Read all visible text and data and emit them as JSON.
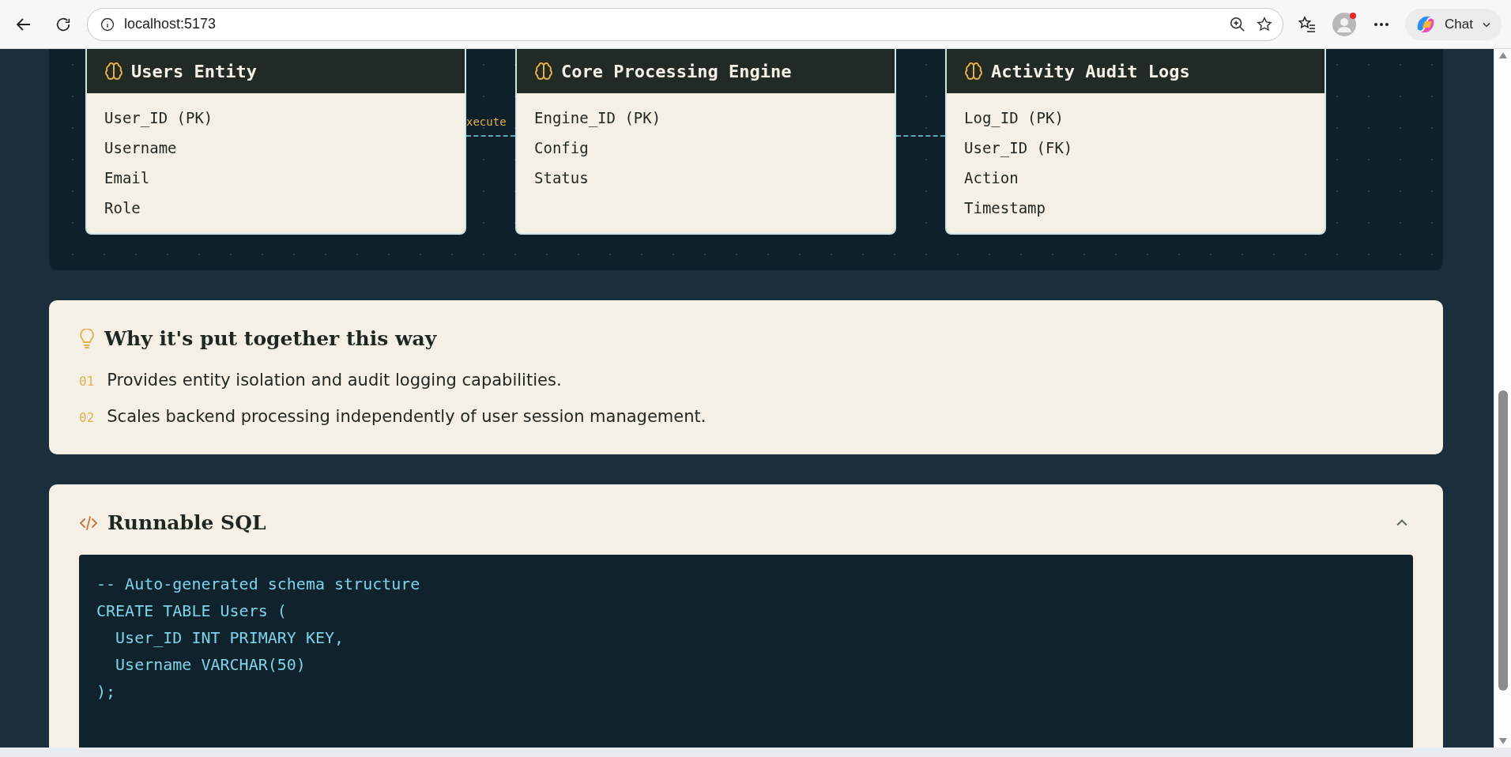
{
  "browser": {
    "address": "localhost:5173",
    "chat_label": "Chat"
  },
  "diagram": {
    "link_label": "xecute",
    "entities": [
      {
        "title": "Users Entity",
        "fields": [
          "User_ID (PK)",
          "Username",
          "Email",
          "Role"
        ]
      },
      {
        "title": "Core Processing Engine",
        "fields": [
          "Engine_ID (PK)",
          "Config",
          "Status"
        ]
      },
      {
        "title": "Activity Audit Logs",
        "fields": [
          "Log_ID (PK)",
          "User_ID (FK)",
          "Action",
          "Timestamp"
        ]
      }
    ]
  },
  "rationale": {
    "title": "Why it's put together this way",
    "items": [
      {
        "number": "01",
        "text": "Provides entity isolation and audit logging capabilities."
      },
      {
        "number": "02",
        "text": "Scales backend processing independently of user session management."
      }
    ]
  },
  "sql": {
    "title": "Runnable SQL",
    "expanded": true,
    "lines": [
      "-- Auto-generated schema structure",
      "CREATE TABLE Users (",
      "  User_ID INT PRIMARY KEY,",
      "  Username VARCHAR(50)",
      ");"
    ]
  }
}
